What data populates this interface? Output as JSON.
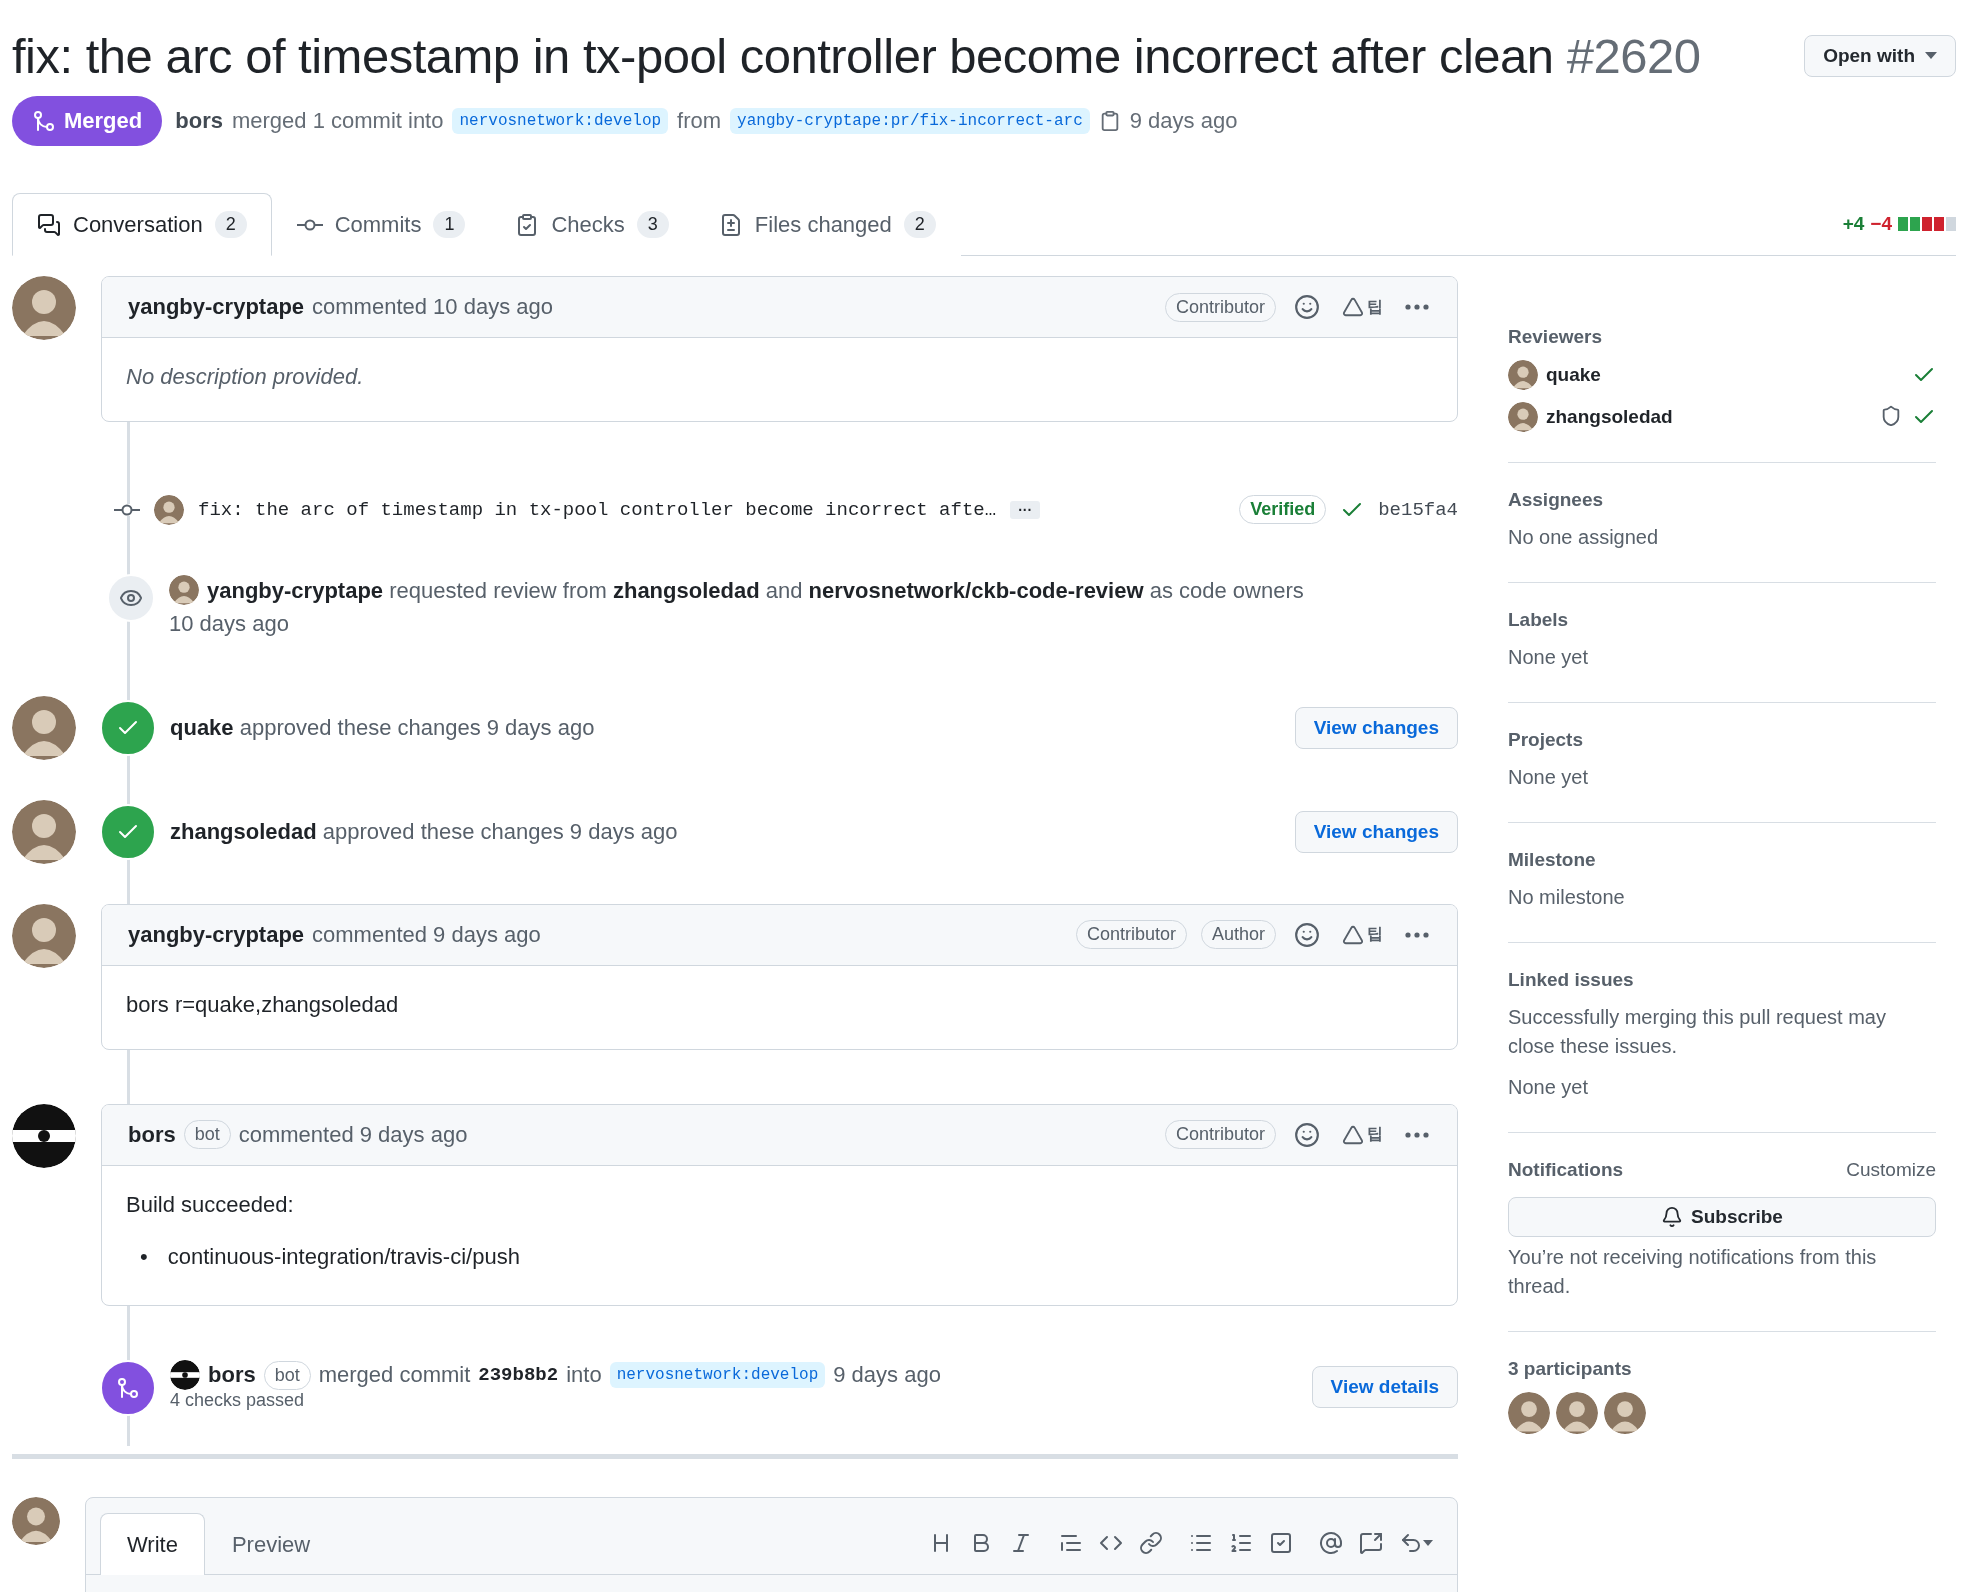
{
  "title": {
    "text": "fix: the arc of timestamp in tx-pool controller become incorrect after clean",
    "number": "#2620"
  },
  "open_with": {
    "label": "Open with"
  },
  "state": {
    "label": "Merged"
  },
  "meta": {
    "actor": "bors",
    "action": "merged 1 commit into",
    "base": "nervosnetwork:develop",
    "from": "from",
    "head": "yangby-cryptape:pr/fix-incorrect-arc",
    "time": "9 days ago"
  },
  "tabs": [
    {
      "kind": "conversation",
      "label": "Conversation",
      "count": "2",
      "selected": true
    },
    {
      "kind": "commits",
      "label": "Commits",
      "count": "1",
      "selected": false
    },
    {
      "kind": "checks",
      "label": "Checks",
      "count": "3",
      "selected": false
    },
    {
      "kind": "files",
      "label": "Files changed",
      "count": "2",
      "selected": false
    }
  ],
  "diffstat": {
    "added": "+4",
    "deleted": "−4",
    "blocks": [
      {
        "kind": "added"
      },
      {
        "kind": "added"
      },
      {
        "kind": "deleted"
      },
      {
        "kind": "deleted"
      },
      {
        "kind": "neutral"
      }
    ]
  },
  "timeline": [
    {
      "kind": "comment",
      "author": "yangby-cryptape",
      "action": "commented 10 days ago",
      "badges": [
        "Contributor"
      ],
      "tip": "팁",
      "body": [
        {
          "kind": "italic",
          "text": "No description provided."
        }
      ]
    },
    {
      "kind": "commit",
      "message": "fix: the arc of timestamp in tx-pool controller become incorrect afte…",
      "more": "···",
      "verified": "Verified",
      "sha": "be15fa4"
    },
    {
      "kind": "review_request",
      "text": "**yangby-cryptape** requested review from **zhangsoledad** and **nervosnetwork/ckb-code-review** as code owners",
      "time": "10 days ago"
    },
    {
      "kind": "review",
      "text": "**quake** approved these changes 9 days ago",
      "button": "View changes"
    },
    {
      "kind": "review",
      "text": "**zhangsoledad** approved these changes 9 days ago",
      "button": "View changes"
    },
    {
      "kind": "comment",
      "author": "yangby-cryptape",
      "action": "commented 9 days ago",
      "badges": [
        "Contributor",
        "Author"
      ],
      "tip": "팁",
      "body": [
        {
          "kind": "paragraph",
          "text": "bors r=quake,zhangsoledad"
        }
      ]
    },
    {
      "kind": "comment",
      "author": "bors",
      "bot": "bot",
      "action": "commented 9 days ago",
      "badges": [
        "Contributor"
      ],
      "tip": "팁",
      "body": [
        {
          "kind": "paragraph",
          "text": "Build succeeded:"
        },
        {
          "kind": "bullet",
          "marker": "•",
          "text": "continuous-integration/travis-ci/push"
        }
      ]
    },
    {
      "kind": "merge",
      "author": "bors",
      "bot": "bot",
      "action": "merged commit",
      "sha": "239b8b2",
      "into": "into",
      "branch": "nervosnetwork:develop",
      "time": "9 days ago",
      "checks": "4 checks passed",
      "button": "View details"
    }
  ],
  "editor": {
    "tabs": [
      {
        "label": "Write",
        "selected": true
      },
      {
        "label": "Preview",
        "selected": false
      }
    ]
  },
  "sidebar": {
    "reviewers": {
      "title": "Reviewers",
      "items": [
        {
          "name": "quake",
          "code_owner": false,
          "approved": true
        },
        {
          "name": "zhangsoledad",
          "code_owner": true,
          "approved": true
        }
      ]
    },
    "sections": [
      {
        "title": "Assignees",
        "lines": [
          "No one assigned"
        ]
      },
      {
        "title": "Labels",
        "lines": [
          "None yet"
        ]
      },
      {
        "title": "Projects",
        "lines": [
          "None yet"
        ]
      },
      {
        "title": "Milestone",
        "lines": [
          "No milestone"
        ]
      },
      {
        "title": "Linked issues",
        "lines": [
          "Successfully merging this pull request may close these issues.",
          "None yet"
        ]
      }
    ],
    "notifications": {
      "title": "Notifications",
      "customize": "Customize",
      "button": "Subscribe",
      "note": "You’re not receiving notifications from this thread."
    },
    "participants": {
      "title": "3 participants",
      "avatars": [
        {
          "kind": "person"
        },
        {
          "kind": "person"
        },
        {
          "kind": "person"
        }
      ]
    }
  }
}
